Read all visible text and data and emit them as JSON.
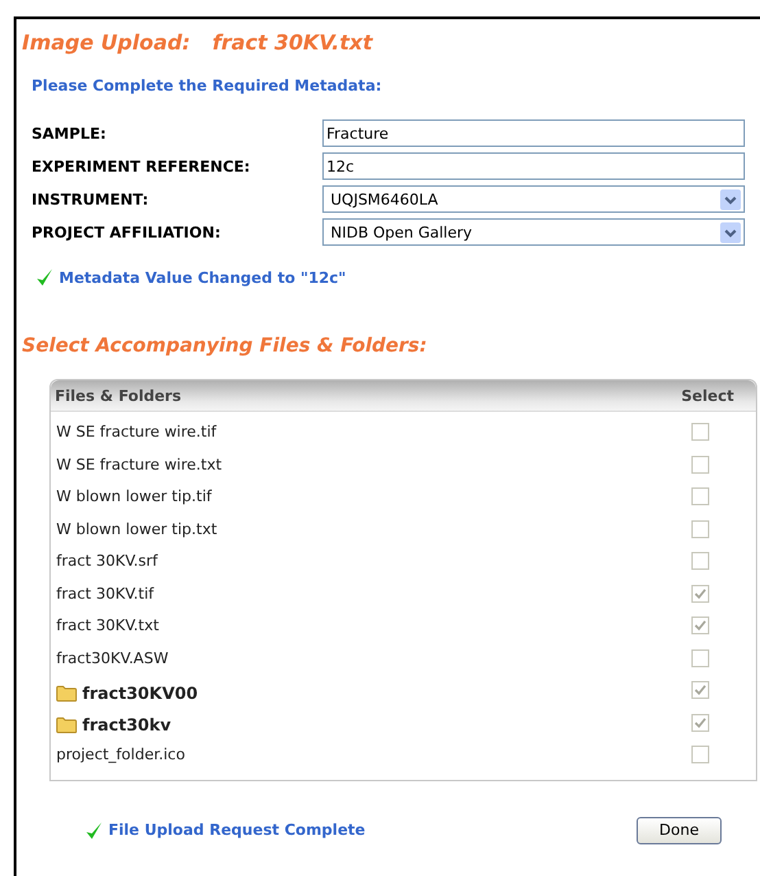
{
  "title": {
    "label": "Image Upload:",
    "file": "fract 30KV.txt"
  },
  "metadata_heading": "Please Complete the Required Metadata:",
  "fields": [
    {
      "kind": "text",
      "label": "SAMPLE:",
      "value": "Fracture"
    },
    {
      "kind": "text",
      "label": "EXPERIMENT REFERENCE:",
      "value": "12c"
    },
    {
      "kind": "select",
      "label": "INSTRUMENT:",
      "value": "UQJSM6460LA"
    },
    {
      "kind": "select",
      "label": "PROJECT AFFILIATION:",
      "value": "NIDB Open Gallery"
    }
  ],
  "metadata_message": "Metadata Value Changed to \"12c\"",
  "files_heading": "Select Accompanying Files & Folders:",
  "table": {
    "columns": [
      "Files & Folders",
      "Select"
    ],
    "rows": [
      {
        "kind": "file",
        "name": "W SE fracture wire.tif",
        "checked": false
      },
      {
        "kind": "file",
        "name": "W SE fracture wire.txt",
        "checked": false
      },
      {
        "kind": "file",
        "name": "W blown lower tip.tif",
        "checked": false
      },
      {
        "kind": "file",
        "name": "W blown lower tip.txt",
        "checked": false
      },
      {
        "kind": "file",
        "name": "fract 30KV.srf",
        "checked": false
      },
      {
        "kind": "file",
        "name": "fract 30KV.tif",
        "checked": true
      },
      {
        "kind": "file",
        "name": "fract 30KV.txt",
        "checked": true
      },
      {
        "kind": "file",
        "name": "fract30KV.ASW",
        "checked": false
      },
      {
        "kind": "folder",
        "name": "fract30KV00",
        "checked": true
      },
      {
        "kind": "folder",
        "name": "fract30kv",
        "checked": true
      },
      {
        "kind": "file",
        "name": "project_folder.ico",
        "checked": false
      }
    ]
  },
  "status_message": "File Upload Request Complete",
  "done_button": "Done"
}
